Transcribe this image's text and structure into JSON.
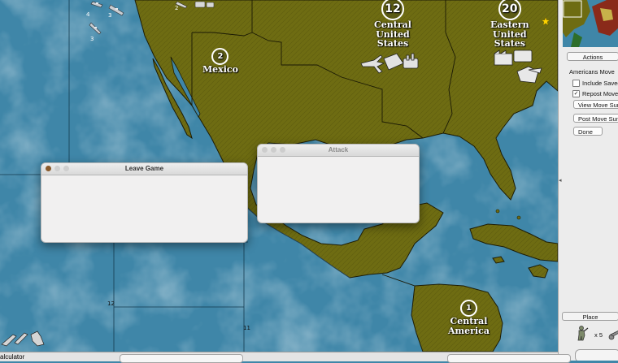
{
  "map": {
    "territories": [
      {
        "name": "Central\nUnited\nStates",
        "production": "12"
      },
      {
        "name": "Eastern\nUnited\nStates",
        "production": "20"
      },
      {
        "name": "Mexico",
        "production": "2"
      },
      {
        "name": "Central\nAmerica",
        "production": "1"
      }
    ],
    "ship_stack_counts": [
      "4",
      "3",
      "3"
    ],
    "unit_small_counts": [
      "2"
    ],
    "sea_zone_numbers": [
      "12",
      "11"
    ]
  },
  "dialogs": {
    "leave_game": {
      "title": "Leave Game"
    },
    "attack": {
      "title": "Attack"
    }
  },
  "panel": {
    "tab_actions": "Actions",
    "move_label": "Americans Move",
    "include_savegame": "Include Savegame",
    "repost_move": "Repost Move",
    "view_move_summary": "View Move Summary",
    "post_move_summary": "Post Move Summary",
    "done": "Done",
    "place_tab": "Place",
    "unit_count": "x 5"
  },
  "status": {
    "calculator": "alculator"
  },
  "colors": {
    "land": "#6e6c12",
    "sea": "#3f86a8",
    "border": "#1d1c06",
    "star": "#ffd400"
  }
}
